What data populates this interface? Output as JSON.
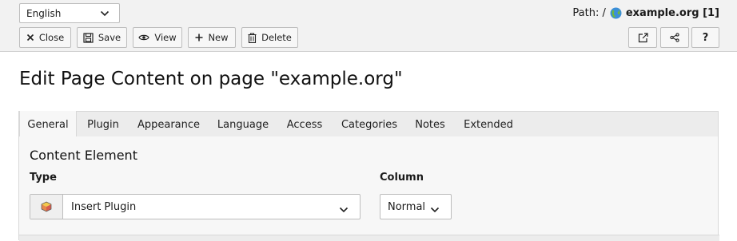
{
  "language_select": {
    "value": "English"
  },
  "path": {
    "label": "Path: /",
    "site": "example.org [1]"
  },
  "toolbar": {
    "close_label": "Close",
    "save_label": "Save",
    "view_label": "View",
    "new_label": "New",
    "delete_label": "Delete"
  },
  "page_title": "Edit Page Content on page \"example.org\"",
  "tabs": [
    "General",
    "Plugin",
    "Appearance",
    "Language",
    "Access",
    "Categories",
    "Notes",
    "Extended"
  ],
  "active_tab": "General",
  "form": {
    "section_title": "Content Element",
    "type_label": "Type",
    "type_value": "Insert Plugin",
    "column_label": "Column",
    "column_value": "Normal"
  },
  "icons": [
    "chevron-down-icon",
    "globe-icon",
    "close-icon",
    "save-icon",
    "view-icon",
    "plus-icon",
    "trash-icon",
    "external-link-icon",
    "share-icon",
    "help-icon",
    "plugin-icon"
  ]
}
